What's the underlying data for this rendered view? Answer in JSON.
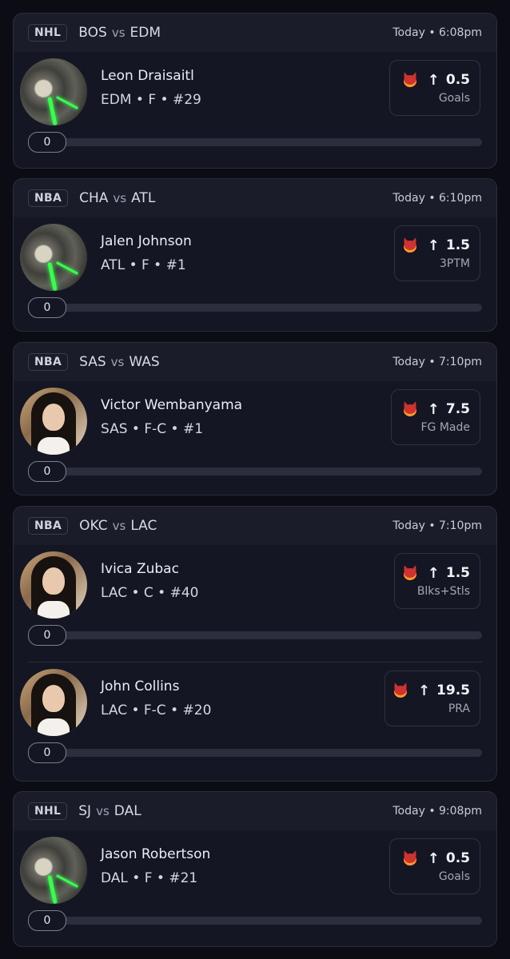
{
  "cards": [
    {
      "league": "NHL",
      "away": "BOS",
      "vs": "vs",
      "home": "EDM",
      "time": "Today • 6:08pm",
      "players": [
        {
          "name": "Leon Draisaitl",
          "meta": "EDM • F • #29",
          "avatar": "dark",
          "arrow": "↑",
          "line": "0.5",
          "stat": "Goals",
          "progress_value": "0",
          "progress_fraction": 0
        }
      ]
    },
    {
      "league": "NBA",
      "away": "CHA",
      "vs": "vs",
      "home": "ATL",
      "time": "Today • 6:10pm",
      "players": [
        {
          "name": "Jalen Johnson",
          "meta": "ATL • F • #1",
          "avatar": "dark",
          "arrow": "↑",
          "line": "1.5",
          "stat": "3PTM",
          "progress_value": "0",
          "progress_fraction": 0
        }
      ]
    },
    {
      "league": "NBA",
      "away": "SAS",
      "vs": "vs",
      "home": "WAS",
      "time": "Today • 7:10pm",
      "players": [
        {
          "name": "Victor Wembanyama",
          "meta": "SAS • F-C • #1",
          "avatar": "photo",
          "arrow": "↑",
          "line": "7.5",
          "stat": "FG Made",
          "progress_value": "0",
          "progress_fraction": 0
        }
      ]
    },
    {
      "league": "NBA",
      "away": "OKC",
      "vs": "vs",
      "home": "LAC",
      "time": "Today • 7:10pm",
      "players": [
        {
          "name": "Ivica Zubac",
          "meta": "LAC • C • #40",
          "avatar": "photo",
          "arrow": "↑",
          "line": "1.5",
          "stat": "Blks+Stls",
          "progress_value": "0",
          "progress_fraction": 0
        },
        {
          "name": "John Collins",
          "meta": "LAC • F-C • #20",
          "avatar": "photo",
          "arrow": "↑",
          "line": "19.5",
          "stat": "PRA",
          "progress_value": "0",
          "progress_fraction": 0
        }
      ]
    },
    {
      "league": "NHL",
      "away": "SJ",
      "vs": "vs",
      "home": "DAL",
      "time": "Today • 9:08pm",
      "players": [
        {
          "name": "Jason Robertson",
          "meta": "DAL • F • #21",
          "avatar": "dark",
          "arrow": "↑",
          "line": "0.5",
          "stat": "Goals",
          "progress_value": "0",
          "progress_fraction": 0
        }
      ]
    }
  ],
  "colors": {
    "background": "#0b0c14",
    "card": "#141623",
    "header": "#1a1c2a",
    "demon": "#d0332f"
  }
}
